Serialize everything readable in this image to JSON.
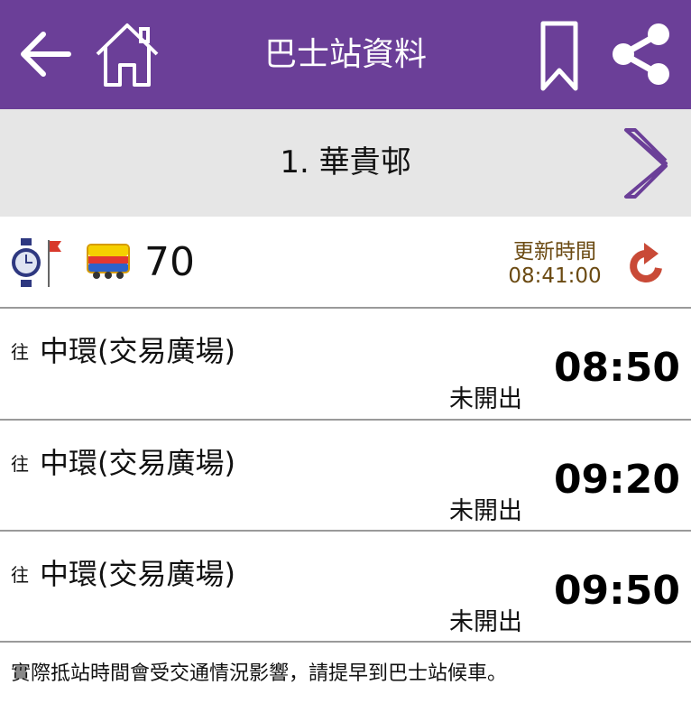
{
  "header": {
    "title": "巴士站資料",
    "back_icon": "back-arrow-icon",
    "home_icon": "home-icon",
    "bookmark_icon": "bookmark-icon",
    "share_icon": "share-icon",
    "bg_color": "#6b3f98"
  },
  "stop": {
    "name": "1. 華貴邨",
    "next_icon": "chevron-right-icon"
  },
  "route": {
    "number": "70",
    "update_label": "更新時間",
    "update_time": "08:41:00",
    "refresh_icon": "refresh-icon"
  },
  "arrivals": [
    {
      "to": "往",
      "destination": "中環(交易廣場)",
      "status": "未開出",
      "eta": "08:50"
    },
    {
      "to": "往",
      "destination": "中環(交易廣場)",
      "status": "未開出",
      "eta": "09:20"
    },
    {
      "to": "往",
      "destination": "中環(交易廣場)",
      "status": "未開出",
      "eta": "09:50"
    }
  ],
  "footer_note": "實際抵站時間會受交通情況影響，請提早到巴士站候車。"
}
